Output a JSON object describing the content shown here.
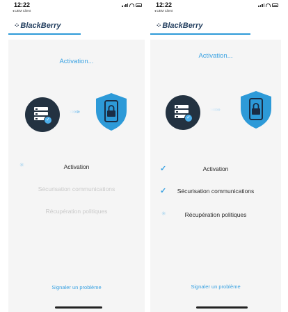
{
  "left": {
    "status_time": "12:22",
    "back_app": "◂ UEM Client",
    "brand_logo": "⁘",
    "brand_name": "BlackBerry",
    "title": "Activation...",
    "chevrons": "»»»",
    "steps": [
      {
        "label": "Activation",
        "state": "in-progress"
      },
      {
        "label": "Sécurisation  communications",
        "state": "pending"
      },
      {
        "label": "Récupération  politiques",
        "state": "pending"
      }
    ],
    "report_link": "Signaler un problème"
  },
  "right": {
    "status_time": "12:22",
    "back_app": "◂ UEM Client",
    "brand_logo": "⁘",
    "brand_name": "BlackBerry",
    "title": "Activation...",
    "chevrons": "»»»",
    "steps": [
      {
        "label": "Activation",
        "state": "done"
      },
      {
        "label": "Sécurisation  communications",
        "state": "done"
      },
      {
        "label": "Récupération  politiques",
        "state": "in-progress"
      }
    ],
    "report_link": "Signaler un problème"
  },
  "icons": {
    "spinner": "✳",
    "checkmark": "✓"
  },
  "colors": {
    "accent": "#3aa2e2",
    "server_circle": "#233241",
    "shield": "#2d9ad8",
    "pending_text": "#c9c9c9"
  }
}
